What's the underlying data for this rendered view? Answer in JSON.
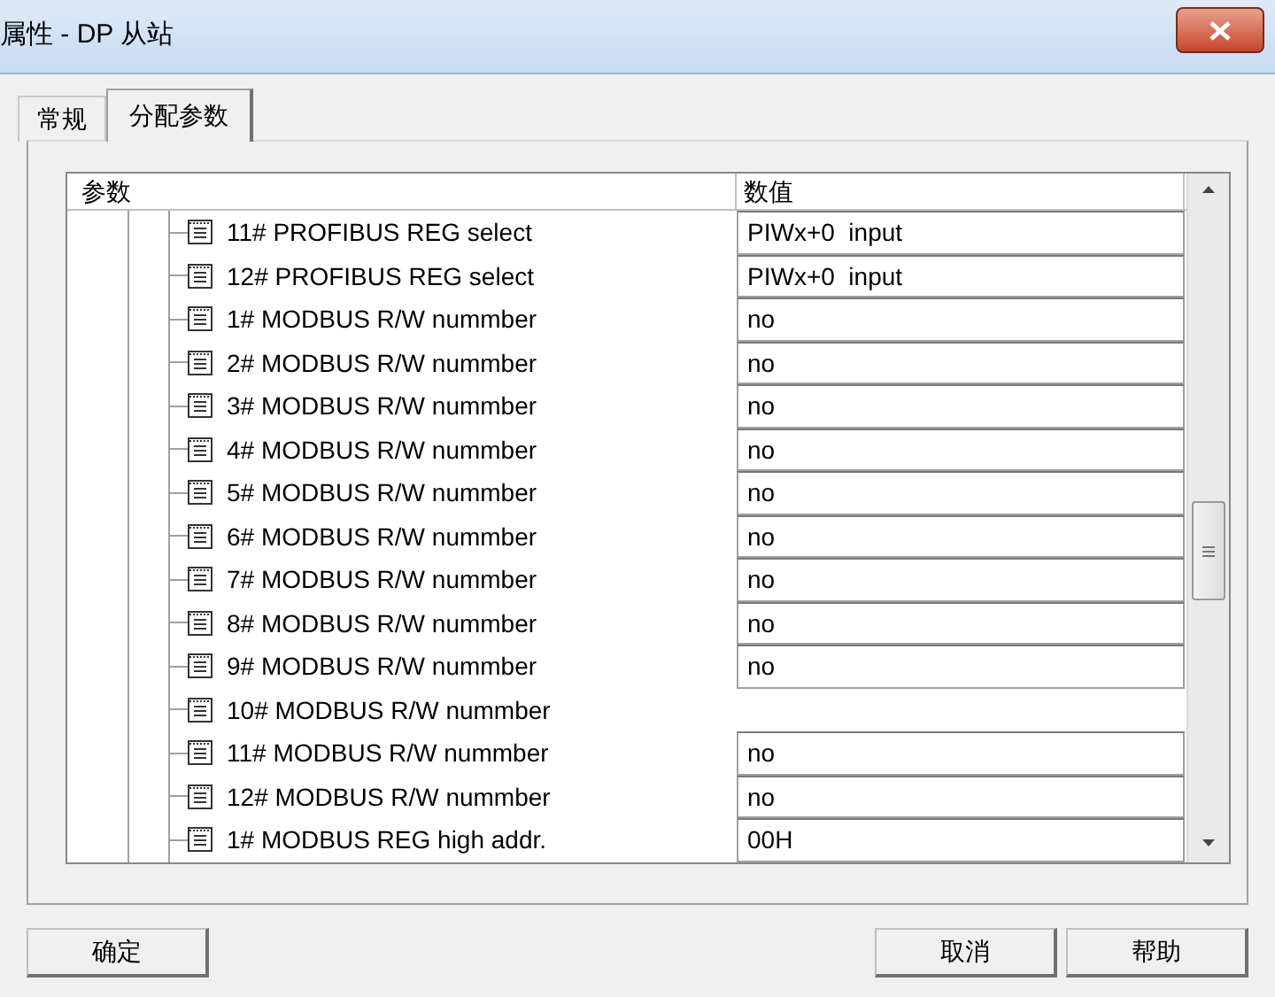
{
  "window": {
    "title": "属性 - DP 从站"
  },
  "tabs": [
    {
      "label": "常规",
      "selected": false
    },
    {
      "label": "分配参数",
      "selected": true
    }
  ],
  "table": {
    "columns": [
      "参数",
      "数值"
    ],
    "rows": [
      {
        "name": "11# PROFIBUS REG select",
        "value": "PIWx+0  input"
      },
      {
        "name": "12# PROFIBUS REG select",
        "value": "PIWx+0  input"
      },
      {
        "name": "1# MODBUS R/W nummber",
        "value": "no"
      },
      {
        "name": "2# MODBUS R/W nummber",
        "value": "no"
      },
      {
        "name": "3# MODBUS R/W nummber",
        "value": "no"
      },
      {
        "name": "4# MODBUS R/W nummber",
        "value": "no"
      },
      {
        "name": "5# MODBUS R/W nummber",
        "value": "no"
      },
      {
        "name": "6# MODBUS R/W nummber",
        "value": "no"
      },
      {
        "name": "7# MODBUS R/W nummber",
        "value": "no"
      },
      {
        "name": "8# MODBUS R/W nummber",
        "value": "no"
      },
      {
        "name": "9# MODBUS R/W nummber",
        "value": "no"
      },
      {
        "name": "10# MODBUS R/W nummber"
      },
      {
        "name": "11# MODBUS R/W nummber",
        "value": "no"
      },
      {
        "name": "12# MODBUS R/W nummber",
        "value": "no"
      },
      {
        "name": "1# MODBUS REG high addr.",
        "value": "00H"
      }
    ]
  },
  "buttons": {
    "left": [
      "确定"
    ],
    "right": [
      "取消",
      "帮助"
    ]
  }
}
